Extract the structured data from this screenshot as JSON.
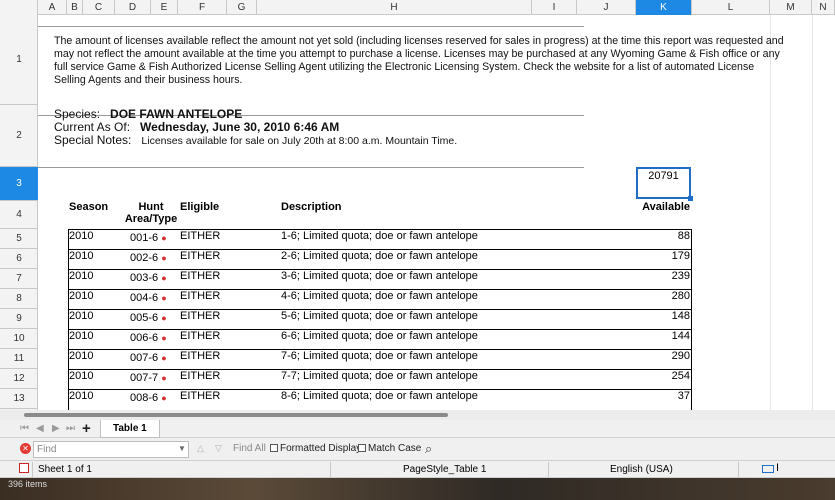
{
  "columns": [
    "A",
    "B",
    "C",
    "D",
    "E",
    "F",
    "G",
    "H",
    "I",
    "J",
    "K",
    "L",
    "M",
    "N"
  ],
  "selected_column": "K",
  "rows": [
    "1",
    "2",
    "3",
    "4",
    "5",
    "6",
    "7",
    "8",
    "9",
    "10",
    "11",
    "12",
    "13"
  ],
  "selected_row": "3",
  "notice": "The amount of licenses available reflect the amount not yet sold (including licenses reserved for sales in progress) at the time this report was requested and may not reflect the amount available at the time you attempt to purchase a license. Licenses may be purchased at any Wyoming Game & Fish office or any full service Game & Fish Authorized License Selling Agent utilizing the Electronic Licensing System. Check the website for a list of automated License Selling Agents and their business hours.",
  "species_label": "Species:",
  "species_value": "DOE FAWN ANTELOPE",
  "current_label": "Current As Of:",
  "current_value": "Wednesday, June 30, 2010 6:46 AM",
  "notes_label": "Special Notes:",
  "notes_value": "Licenses available for sale on July 20th at 8:00 a.m. Mountain Time.",
  "selected_cell_value": "20791",
  "table": {
    "headers": {
      "season": "Season",
      "hunt_area_1": "Hunt",
      "hunt_area_2": "Area/Type",
      "eligible": "Eligible",
      "description": "Description",
      "available": "Available"
    },
    "rows": [
      {
        "season": "2010",
        "hunt": "001-6",
        "eligible": "EITHER",
        "description": "1-6; Limited quota; doe or fawn antelope",
        "available": "88"
      },
      {
        "season": "2010",
        "hunt": "002-6",
        "eligible": "EITHER",
        "description": "2-6; Limited quota; doe or fawn antelope",
        "available": "179"
      },
      {
        "season": "2010",
        "hunt": "003-6",
        "eligible": "EITHER",
        "description": "3-6; Limited quota; doe or fawn antelope",
        "available": "239"
      },
      {
        "season": "2010",
        "hunt": "004-6",
        "eligible": "EITHER",
        "description": "4-6; Limited quota; doe or fawn antelope",
        "available": "280"
      },
      {
        "season": "2010",
        "hunt": "005-6",
        "eligible": "EITHER",
        "description": "5-6; Limited quota; doe or fawn antelope",
        "available": "148"
      },
      {
        "season": "2010",
        "hunt": "006-6",
        "eligible": "EITHER",
        "description": "6-6; Limited quota; doe or fawn antelope",
        "available": "144"
      },
      {
        "season": "2010",
        "hunt": "007-6",
        "eligible": "EITHER",
        "description": "7-6; Limited quota; doe or fawn antelope",
        "available": "290"
      },
      {
        "season": "2010",
        "hunt": "007-7",
        "eligible": "EITHER",
        "description": "7-7; Limited quota; doe or fawn antelope",
        "available": "254"
      },
      {
        "season": "2010",
        "hunt": "008-6",
        "eligible": "EITHER",
        "description": "8-6; Limited quota; doe or fawn antelope",
        "available": "37"
      }
    ]
  },
  "tabs": {
    "add_symbol": "+",
    "active_tab": "Table 1"
  },
  "findbar": {
    "placeholder": "Find",
    "find_all": "Find All",
    "formatted_display": "Formatted Display",
    "match_case": "Match Case"
  },
  "status": {
    "sheet": "Sheet 1 of 1",
    "page_style": "PageStyle_Table 1",
    "language": "English (USA)"
  },
  "taskbar_text": "396 items",
  "colors": {
    "accent": "#1e88e5",
    "selection_border": "#1e6ec8",
    "marker": "#d32f2f"
  }
}
